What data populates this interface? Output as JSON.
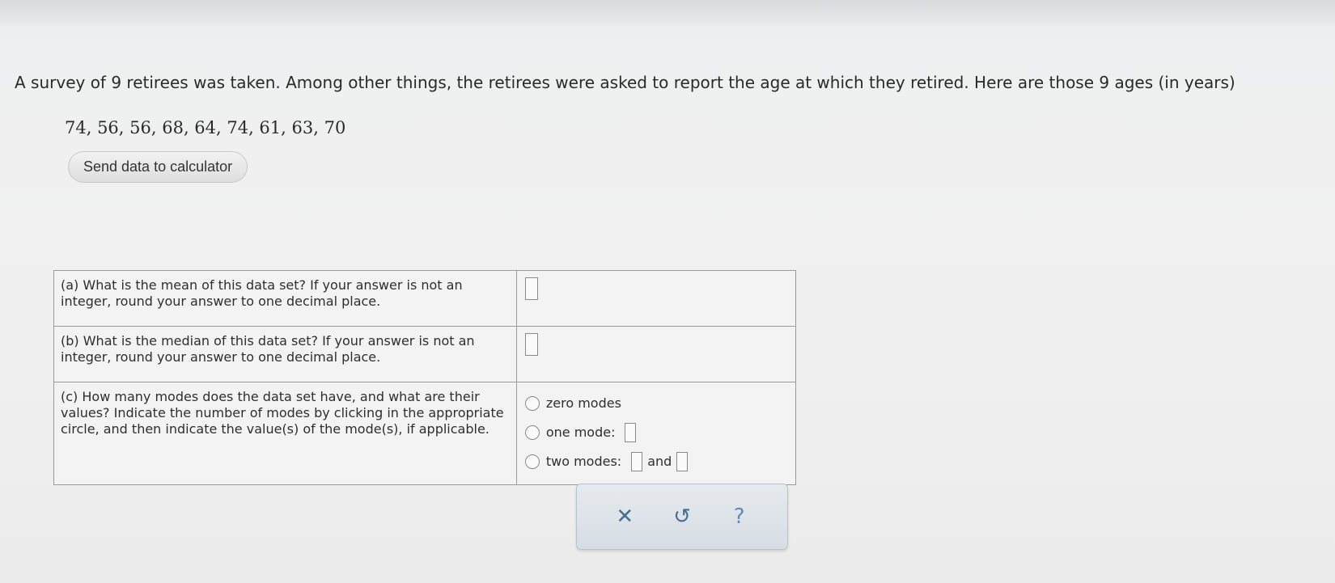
{
  "problem": {
    "intro": "A survey of 9 retirees was taken. Among other things, the retirees were asked to report the age at which they retired. Here are those 9 ages (in years)",
    "data_values": "74, 56, 56, 68, 64, 74, 61, 63, 70",
    "send_button_label": "Send data to calculator"
  },
  "questions": {
    "a": "(a) What is the mean of this data set? If your answer is not an integer, round your answer to one decimal place.",
    "b": "(b) What is the median of this data set? If your answer is not an integer, round your answer to one decimal place.",
    "c": "(c) How many modes does the data set have, and what are their values? Indicate the number of modes by clicking in the appropriate circle, and then indicate the value(s) of the mode(s), if applicable."
  },
  "mode_options": {
    "zero": "zero modes",
    "one": "one mode:",
    "two": "two modes:",
    "and": "and"
  },
  "actions": {
    "clear": "✕",
    "undo": "↺",
    "help": "?"
  }
}
